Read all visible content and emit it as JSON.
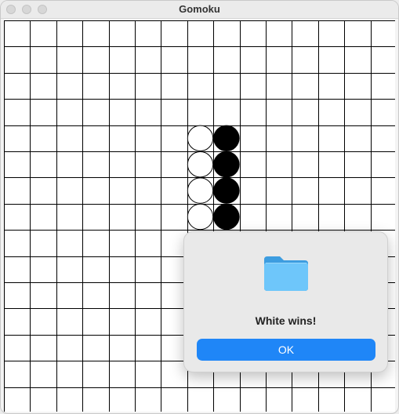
{
  "window": {
    "title": "Gomoku"
  },
  "board": {
    "size": 15,
    "stones": [
      {
        "col": 7,
        "row": 4,
        "color": "white"
      },
      {
        "col": 7,
        "row": 5,
        "color": "white"
      },
      {
        "col": 7,
        "row": 6,
        "color": "white"
      },
      {
        "col": 7,
        "row": 7,
        "color": "white"
      },
      {
        "col": 8,
        "row": 4,
        "color": "black"
      },
      {
        "col": 8,
        "row": 5,
        "color": "black"
      },
      {
        "col": 8,
        "row": 6,
        "color": "black"
      },
      {
        "col": 8,
        "row": 7,
        "color": "black"
      }
    ]
  },
  "dialog": {
    "icon": "folder-icon",
    "message": "White wins!",
    "ok_label": "OK"
  },
  "colors": {
    "accent": "#1f86f7",
    "folder": "#5ab8f5"
  }
}
